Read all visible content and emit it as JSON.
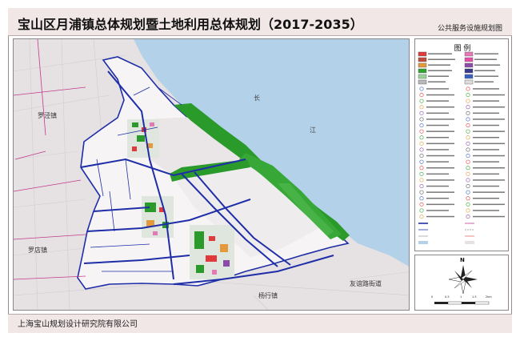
{
  "header": {
    "title": "宝山区月浦镇总体规划暨土地利用总体规划（2017-2035）",
    "subtitle": "公共服务设施规划图"
  },
  "footer": {
    "organization": "上海宝山规划设计研究院有限公司"
  },
  "map": {
    "place_labels": {
      "luojing": "罗泾镇",
      "luodian": "罗店镇",
      "yanghang": "杨行镇",
      "youyi": "友谊路街道"
    },
    "river_chars": [
      "长",
      "江"
    ]
  },
  "legend": {
    "title": "图  例",
    "colors": {
      "red": "#e03a3a",
      "pink": "#e678b8",
      "green": "#2fa52f",
      "light_green": "#9ad29a",
      "orange": "#e49a3a",
      "purple": "#8b4ba8",
      "blue": "#3a5fc0",
      "grey": "#b8b8b8",
      "white": "#ffffff"
    }
  },
  "compass": {
    "north": "N",
    "scale_marks": [
      "0",
      "0.5",
      "1",
      "1.5",
      "2km"
    ]
  },
  "colors": {
    "water": "#afd0ea",
    "land": "#ede9ea",
    "planning_area": "#f4f2f2",
    "road_blue": "#1f2ea8",
    "road_magenta": "#c23a8c",
    "green": "#2a9a2a",
    "title_bg": "#f1e7e7"
  }
}
